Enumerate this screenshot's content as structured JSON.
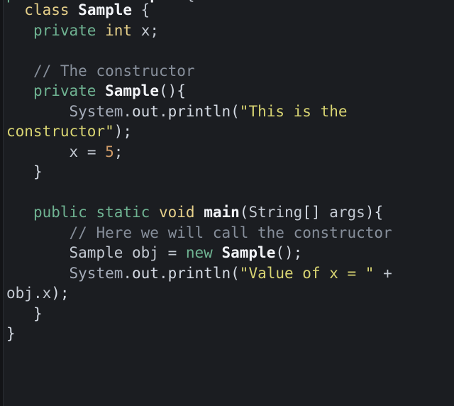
{
  "editor": {
    "language": "java",
    "theme_name": "dark",
    "background_color": "#1b1d21",
    "font_size_px": 21,
    "line_height_px": 28.5,
    "colors": {
      "background": "#1b1d21",
      "gutter": "#131417",
      "default_text": "#c7ccd4",
      "keyword": "#e6d08a",
      "modifier": "#6fb392",
      "type": "#f2f4f8",
      "identifier": "#a7aebb",
      "member": "#d5dbe4",
      "string": "#d8d472",
      "number": "#cf9b68",
      "comment": "#878f9b"
    }
  },
  "clipped_line": {
    "segments": [
      {
        "text": "public ",
        "kind": "modifier"
      },
      {
        "text": "class ",
        "kind": "keyword"
      },
      {
        "text": "Sample",
        "kind": "type"
      },
      {
        "text": " {",
        "kind": "punct"
      }
    ]
  },
  "code_lines": [
    {
      "id": "line-class-decl",
      "plain": "  class Sample {",
      "segments": [
        {
          "text": "  ",
          "kind": "plain"
        },
        {
          "text": "class",
          "kind": "keyword"
        },
        {
          "text": " ",
          "kind": "plain"
        },
        {
          "text": "Sample",
          "kind": "type"
        },
        {
          "text": " {",
          "kind": "punct"
        }
      ]
    },
    {
      "id": "line-field-x",
      "plain": "   private int x;",
      "segments": [
        {
          "text": "   ",
          "kind": "plain"
        },
        {
          "text": "private",
          "kind": "modifier"
        },
        {
          "text": " ",
          "kind": "plain"
        },
        {
          "text": "int",
          "kind": "keyword"
        },
        {
          "text": " ",
          "kind": "plain"
        },
        {
          "text": "x",
          "kind": "plain"
        },
        {
          "text": ";",
          "kind": "punct"
        }
      ]
    },
    {
      "id": "line-blank-1",
      "plain": "",
      "segments": []
    },
    {
      "id": "line-comment-constructor",
      "plain": "   // The constructor",
      "segments": [
        {
          "text": "   ",
          "kind": "plain"
        },
        {
          "text": "// The constructor",
          "kind": "comment"
        }
      ]
    },
    {
      "id": "line-constructor-decl",
      "plain": "   private Sample(){",
      "segments": [
        {
          "text": "   ",
          "kind": "plain"
        },
        {
          "text": "private",
          "kind": "modifier"
        },
        {
          "text": " ",
          "kind": "plain"
        },
        {
          "text": "Sample",
          "kind": "type"
        },
        {
          "text": "(){",
          "kind": "bracket"
        }
      ]
    },
    {
      "id": "line-println-constructor",
      "plain": "       System.out.println(\"This is the constructor\");",
      "segments": [
        {
          "text": "       ",
          "kind": "plain"
        },
        {
          "text": "System",
          "kind": "ident"
        },
        {
          "text": ".",
          "kind": "punct"
        },
        {
          "text": "out",
          "kind": "member"
        },
        {
          "text": ".",
          "kind": "punct"
        },
        {
          "text": "println",
          "kind": "member"
        },
        {
          "text": "(",
          "kind": "bracket"
        },
        {
          "text": "\"This is the constructor\"",
          "kind": "string"
        },
        {
          "text": ");",
          "kind": "bracket"
        }
      ]
    },
    {
      "id": "line-assign-x",
      "plain": "       x = 5;",
      "segments": [
        {
          "text": "       ",
          "kind": "plain"
        },
        {
          "text": "x",
          "kind": "plain"
        },
        {
          "text": " = ",
          "kind": "plain"
        },
        {
          "text": "5",
          "kind": "number"
        },
        {
          "text": ";",
          "kind": "punct"
        }
      ]
    },
    {
      "id": "line-close-constructor",
      "plain": "   }",
      "segments": [
        {
          "text": "   ",
          "kind": "plain"
        },
        {
          "text": "}",
          "kind": "bracket"
        }
      ]
    },
    {
      "id": "line-blank-2",
      "plain": "",
      "segments": []
    },
    {
      "id": "line-main-decl",
      "plain": "   public static void main(String[] args){",
      "segments": [
        {
          "text": "   ",
          "kind": "plain"
        },
        {
          "text": "public",
          "kind": "modifier"
        },
        {
          "text": " ",
          "kind": "plain"
        },
        {
          "text": "static",
          "kind": "modifier"
        },
        {
          "text": " ",
          "kind": "plain"
        },
        {
          "text": "void",
          "kind": "keyword"
        },
        {
          "text": " ",
          "kind": "plain"
        },
        {
          "text": "main",
          "kind": "type"
        },
        {
          "text": "(",
          "kind": "bracket"
        },
        {
          "text": "String",
          "kind": "plain"
        },
        {
          "text": "[] ",
          "kind": "bracket"
        },
        {
          "text": "args",
          "kind": "plain"
        },
        {
          "text": "){",
          "kind": "bracket"
        }
      ]
    },
    {
      "id": "line-comment-call",
      "plain": "       // Here we will call the constructor",
      "segments": [
        {
          "text": "       ",
          "kind": "plain"
        },
        {
          "text": "// Here we will call the constructor",
          "kind": "comment"
        }
      ]
    },
    {
      "id": "line-new-sample",
      "plain": "       Sample obj = new Sample();",
      "segments": [
        {
          "text": "       ",
          "kind": "plain"
        },
        {
          "text": "Sample",
          "kind": "plain"
        },
        {
          "text": " obj = ",
          "kind": "plain"
        },
        {
          "text": "new",
          "kind": "modifier"
        },
        {
          "text": " ",
          "kind": "plain"
        },
        {
          "text": "Sample",
          "kind": "type"
        },
        {
          "text": "();",
          "kind": "bracket"
        }
      ]
    },
    {
      "id": "line-println-value",
      "plain": "       System.out.println(\"Value of x = \" + obj.x);",
      "segments": [
        {
          "text": "       ",
          "kind": "plain"
        },
        {
          "text": "System",
          "kind": "ident"
        },
        {
          "text": ".",
          "kind": "punct"
        },
        {
          "text": "out",
          "kind": "member"
        },
        {
          "text": ".",
          "kind": "punct"
        },
        {
          "text": "println",
          "kind": "member"
        },
        {
          "text": "(",
          "kind": "bracket"
        },
        {
          "text": "\"Value of x = \"",
          "kind": "string"
        },
        {
          "text": " + ",
          "kind": "plain"
        },
        {
          "text": "obj",
          "kind": "plain"
        },
        {
          "text": ".",
          "kind": "punct"
        },
        {
          "text": "x",
          "kind": "plain"
        },
        {
          "text": ");",
          "kind": "bracket"
        }
      ]
    },
    {
      "id": "line-close-main",
      "plain": "   }",
      "segments": [
        {
          "text": "   ",
          "kind": "plain"
        },
        {
          "text": "}",
          "kind": "bracket"
        }
      ]
    },
    {
      "id": "line-close-class",
      "plain": "}",
      "segments": [
        {
          "text": "}",
          "kind": "bracket"
        }
      ]
    }
  ]
}
